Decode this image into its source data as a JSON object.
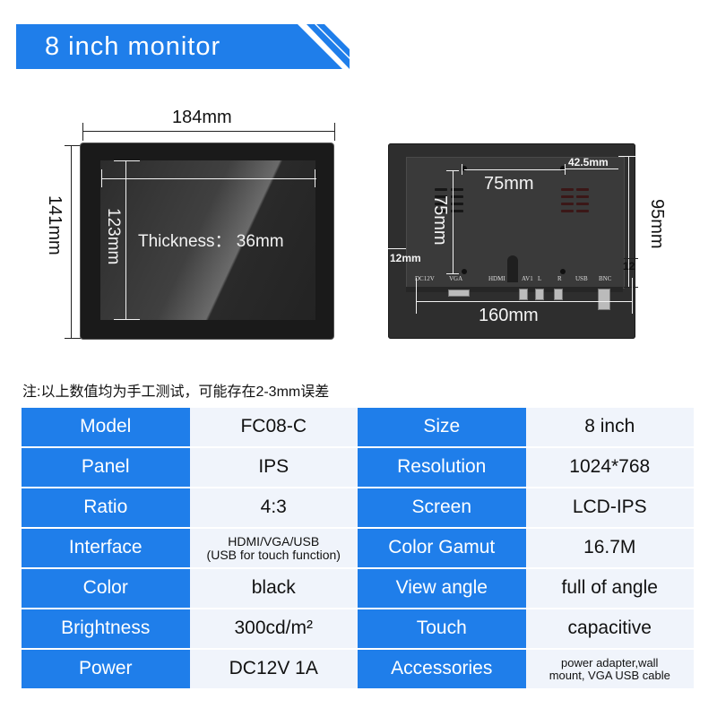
{
  "banner": {
    "title": "8 inch monitor"
  },
  "front_view": {
    "width_label": "184mm",
    "height_label": "141mm",
    "screen_height_label": "123mm",
    "thickness_label": "Thickness： 36mm"
  },
  "back_view": {
    "vesa_horizontal_label": "75mm",
    "vesa_vertical_label": "75mm",
    "offset_top_label": "42.5mm",
    "height_label": "95mm",
    "offset_left_label": "12mm",
    "offset_right_label": "12",
    "width_label": "160mm",
    "ports": [
      "DC12V",
      "VGA",
      "HDMI",
      "AV1",
      "L",
      "R",
      "USB",
      "BNC"
    ]
  },
  "note": "注:以上数值均为手工测试，可能存在2-3mm误差",
  "specs": {
    "rows": [
      {
        "k1": "Model",
        "v1": "FC08-C",
        "k2": "Size",
        "v2": "8 inch"
      },
      {
        "k1": "Panel",
        "v1": "IPS",
        "k2": "Resolution",
        "v2": "1024*768"
      },
      {
        "k1": "Ratio",
        "v1": "4:3",
        "k2": "Screen",
        "v2": "LCD-IPS"
      },
      {
        "k1": "Interface",
        "v1_line1": "HDMI/VGA/USB",
        "v1_line2": "(USB for touch function)",
        "k2": "Color Gamut",
        "v2": "16.7M"
      },
      {
        "k1": "Color",
        "v1": "black",
        "k2": "View angle",
        "v2": "full of angle"
      },
      {
        "k1": "Brightness",
        "v1": "300cd/m²",
        "k2": "Touch",
        "v2": "capacitive"
      },
      {
        "k1": "Power",
        "v1": "DC12V 1A",
        "k2": "Accessories",
        "v2_line1": "power adapter,wall",
        "v2_line2": "mount, VGA USB cable"
      }
    ]
  },
  "colors": {
    "accent": "#1f7eea",
    "value_cell": "#f0f4fb"
  }
}
